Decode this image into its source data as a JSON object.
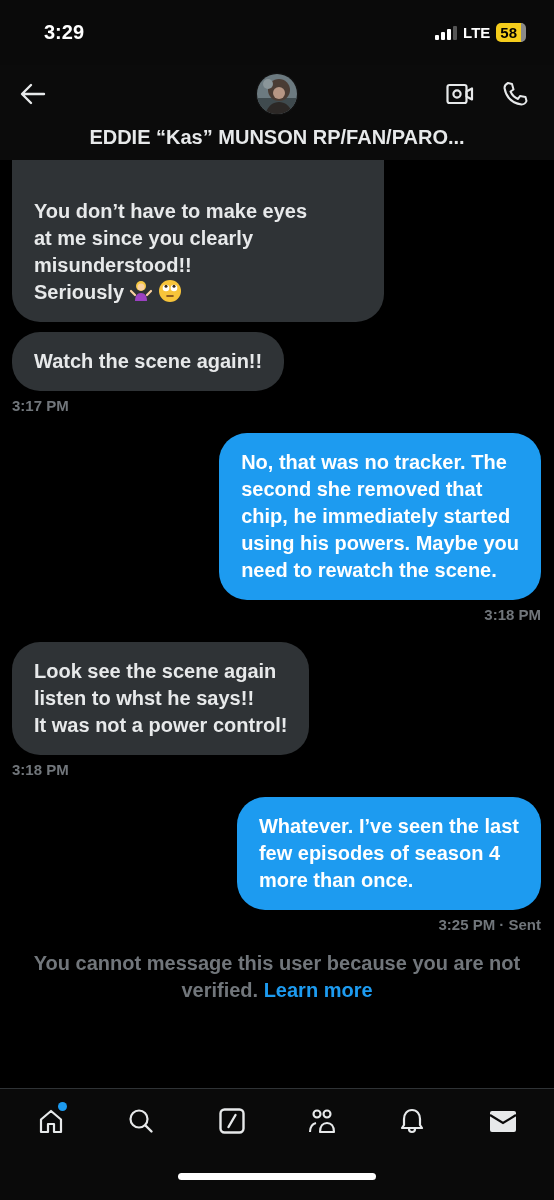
{
  "status_bar": {
    "time": "3:29",
    "network": "LTE",
    "battery": "58"
  },
  "header": {
    "title": "EDDIE “Kas” MUNSON RP/FAN/PARO..."
  },
  "messages": [
    {
      "kind": "received",
      "text": "You don’t have to make eyes\nat me since you clearly\nmisunderstood!!\nSeriously",
      "emoji": [
        {
          "kind": "shrug"
        },
        {
          "kind": "eye-roll"
        }
      ],
      "clipped_top": true
    },
    {
      "kind": "received",
      "text": "Watch the scene again!!",
      "time": "3:17 PM"
    },
    {
      "kind": "sent",
      "text": "No, that was no tracker. The\nsecond she removed that\nchip, he immediately started\nusing his powers. Maybe you\nneed to rewatch the scene.",
      "time": "3:18 PM"
    },
    {
      "kind": "received",
      "text": "Look see the scene again\nlisten to whst he says!!\nIt was not a power control!",
      "time": "3:18 PM"
    },
    {
      "kind": "sent",
      "text": "Whatever. I’ve seen the last\nfew episodes of season 4\nmore than once.",
      "time": "3:25 PM · Sent"
    }
  ],
  "notice": {
    "text": "You cannot message this user because you are not verified.",
    "link": "Learn more"
  },
  "nav": [
    {
      "kind": "home",
      "selected": false,
      "badge": true
    },
    {
      "kind": "search",
      "selected": false,
      "badge": false
    },
    {
      "kind": "compose",
      "selected": false,
      "badge": false
    },
    {
      "kind": "communities",
      "selected": false,
      "badge": false
    },
    {
      "kind": "notifications",
      "selected": false,
      "badge": false
    },
    {
      "kind": "messages",
      "selected": true,
      "badge": false
    }
  ]
}
